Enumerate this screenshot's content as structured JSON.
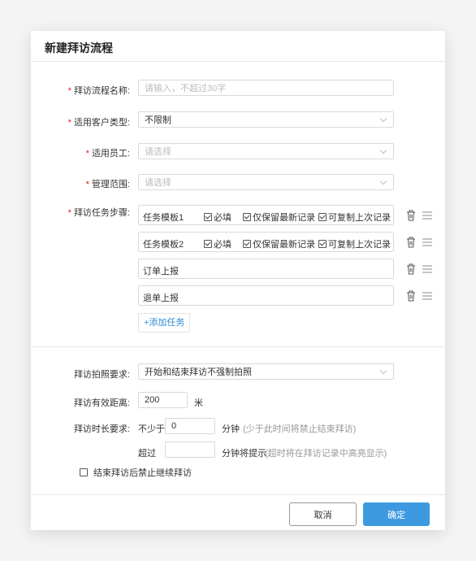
{
  "dialog": {
    "title": "新建拜访流程"
  },
  "form": {
    "required_mark": "*",
    "name": {
      "label": "拜访流程名称:",
      "placeholder": "请输入，不超过30字"
    },
    "customer_type": {
      "label": "适用客户类型:",
      "value": "不限制"
    },
    "employees": {
      "label": "适用员工:",
      "placeholder": "请选择"
    },
    "scope": {
      "label": "管理范围:",
      "placeholder": "请选择"
    },
    "steps": {
      "label": "拜访任务步骤:",
      "tasks": [
        {
          "name": "任务模板1",
          "options": [
            {
              "label": "必填",
              "checked": true
            },
            {
              "label": "仅保留最新记录",
              "checked": true
            },
            {
              "label": "可复制上次记录",
              "checked": true
            }
          ]
        },
        {
          "name": "任务模板2",
          "options": [
            {
              "label": "必填",
              "checked": true
            },
            {
              "label": "仅保留最新记录",
              "checked": true
            },
            {
              "label": "可复制上次记录",
              "checked": true
            }
          ]
        },
        {
          "name": "订单上报",
          "options": []
        },
        {
          "name": "退单上报",
          "options": []
        }
      ],
      "add_label": "+添加任务"
    },
    "photo": {
      "label": "拜访拍照要求:",
      "value": "开始和结束拜访不强制拍照"
    },
    "distance": {
      "label": "拜访有效距离:",
      "value": "200",
      "unit": "米"
    },
    "duration": {
      "label": "拜访时长要求:",
      "min_prefix": "不少于",
      "min_value": "0",
      "min_unit": "分钟",
      "min_hint": "(少于此时间将禁止结束拜访)",
      "max_prefix": "超过",
      "max_value": "",
      "max_unit": "分钟将提示",
      "max_hint": "(超时将在拜访记录中高亮显示)"
    },
    "block_after": {
      "label": "结束拜访后禁止继续拜访",
      "checked": false
    }
  },
  "footer": {
    "cancel_label": "取消",
    "confirm_label": "确定"
  },
  "colors": {
    "primary": "#3d9ae0",
    "required": "#e02020",
    "link": "#2b8ad8"
  },
  "icons": {
    "task_delete": "trash-icon",
    "task_drag": "drag-handle-icon",
    "select_arrow": "chevron-down-icon"
  }
}
